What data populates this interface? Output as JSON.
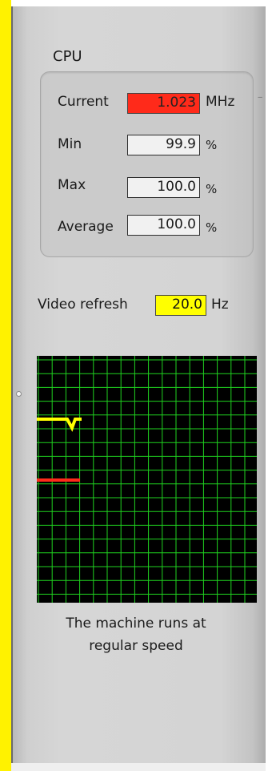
{
  "cpu": {
    "title": "CPU",
    "current": {
      "label": "Current",
      "value": "1.023",
      "unit": "MHz"
    },
    "min": {
      "label": "Min",
      "value": "99.9",
      "unit": "%"
    },
    "max": {
      "label": "Max",
      "value": "100.0",
      "unit": "%"
    },
    "average": {
      "label": "Average",
      "value": "100.0",
      "unit": "%"
    }
  },
  "video": {
    "label": "Video refresh",
    "value": "20.0",
    "unit": "Hz"
  },
  "graph": {
    "grid_color": "#1fd21f",
    "background": "#000000",
    "series": [
      {
        "color": "#ffff00"
      },
      {
        "color": "#ff2a1a"
      }
    ]
  },
  "status": {
    "line1": "The machine runs at",
    "line2": "regular speed"
  },
  "colors": {
    "current_bg": "#ff2a1a",
    "video_bg": "#ffff00",
    "left_bar": "#fff200"
  }
}
